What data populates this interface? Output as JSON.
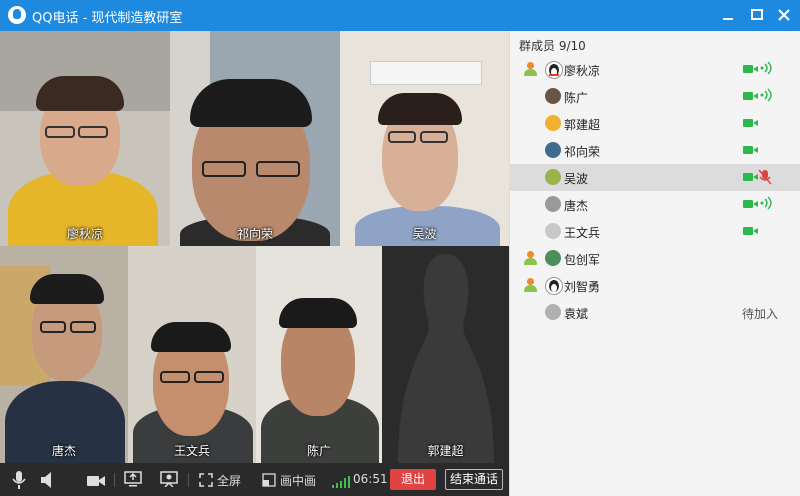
{
  "window": {
    "title": "QQ电话 - 现代制造教研室"
  },
  "videos": [
    {
      "name": "廖秋凉"
    },
    {
      "name": "祁向荣"
    },
    {
      "name": "吴波"
    },
    {
      "name": "唐杰"
    },
    {
      "name": "王文兵"
    },
    {
      "name": "陈广"
    },
    {
      "name": "郭建超"
    }
  ],
  "controls": {
    "fullscreen_label": "全屏",
    "pip_label": "画中画",
    "duration": "06:51",
    "exit_label": "退出",
    "end_label": "结束通话"
  },
  "members_panel": {
    "title": "群成员 9/10",
    "members": [
      {
        "name": "廖秋凉",
        "host": true,
        "camera": true,
        "speaking": true,
        "status": ""
      },
      {
        "name": "陈广",
        "host": false,
        "camera": true,
        "speaking": true,
        "status": ""
      },
      {
        "name": "郭建超",
        "host": false,
        "camera": true,
        "speaking": false,
        "status": ""
      },
      {
        "name": "祁向荣",
        "host": false,
        "camera": true,
        "speaking": false,
        "status": ""
      },
      {
        "name": "吴波",
        "host": false,
        "camera": true,
        "muted": true,
        "status": ""
      },
      {
        "name": "唐杰",
        "host": false,
        "camera": true,
        "speaking": true,
        "status": ""
      },
      {
        "name": "王文兵",
        "host": false,
        "camera": true,
        "speaking": false,
        "status": ""
      },
      {
        "name": "包创军",
        "host": true,
        "camera": false,
        "speaking": false,
        "status": ""
      },
      {
        "name": "刘智勇",
        "host": true,
        "camera": false,
        "speaking": false,
        "status": ""
      },
      {
        "name": "袁斌",
        "host": false,
        "camera": false,
        "speaking": false,
        "status": "待加入"
      }
    ]
  },
  "colors": {
    "titlebar": "#1d8ae0",
    "accent_green": "#2db84d",
    "exit_red": "#e04343"
  }
}
